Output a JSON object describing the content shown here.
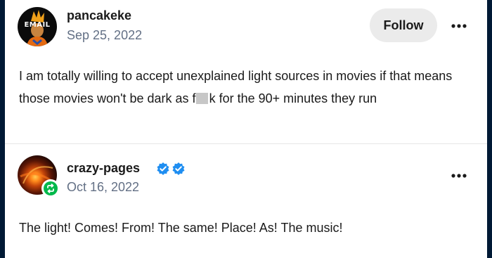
{
  "posts": [
    {
      "author": "pancakeke",
      "date": "Sep 25, 2022",
      "avatar_text": "EMAIL",
      "follow_label": "Follow",
      "text_before": "I am totally willing to accept unexplained light sources in movies if that means those movies won't be dark as f",
      "text_after": "k for the 90+ minutes they run"
    },
    {
      "author": "crazy-pages",
      "date": "Oct 16, 2022",
      "text": "The light! Comes! From! The same! Place! As! The music!",
      "verified_badges": 2,
      "reblogged": true
    }
  ],
  "icons": {
    "more": "more-horizontal-icon",
    "verified": "verified-badge-icon",
    "reblog": "reblog-icon"
  },
  "colors": {
    "background_dark": "#001935",
    "text_primary": "#1a1a1a",
    "text_secondary": "#637085",
    "follow_bg": "#ebebeb",
    "verified_blue": "#1f8ef1",
    "reblog_green": "#00b84a"
  }
}
